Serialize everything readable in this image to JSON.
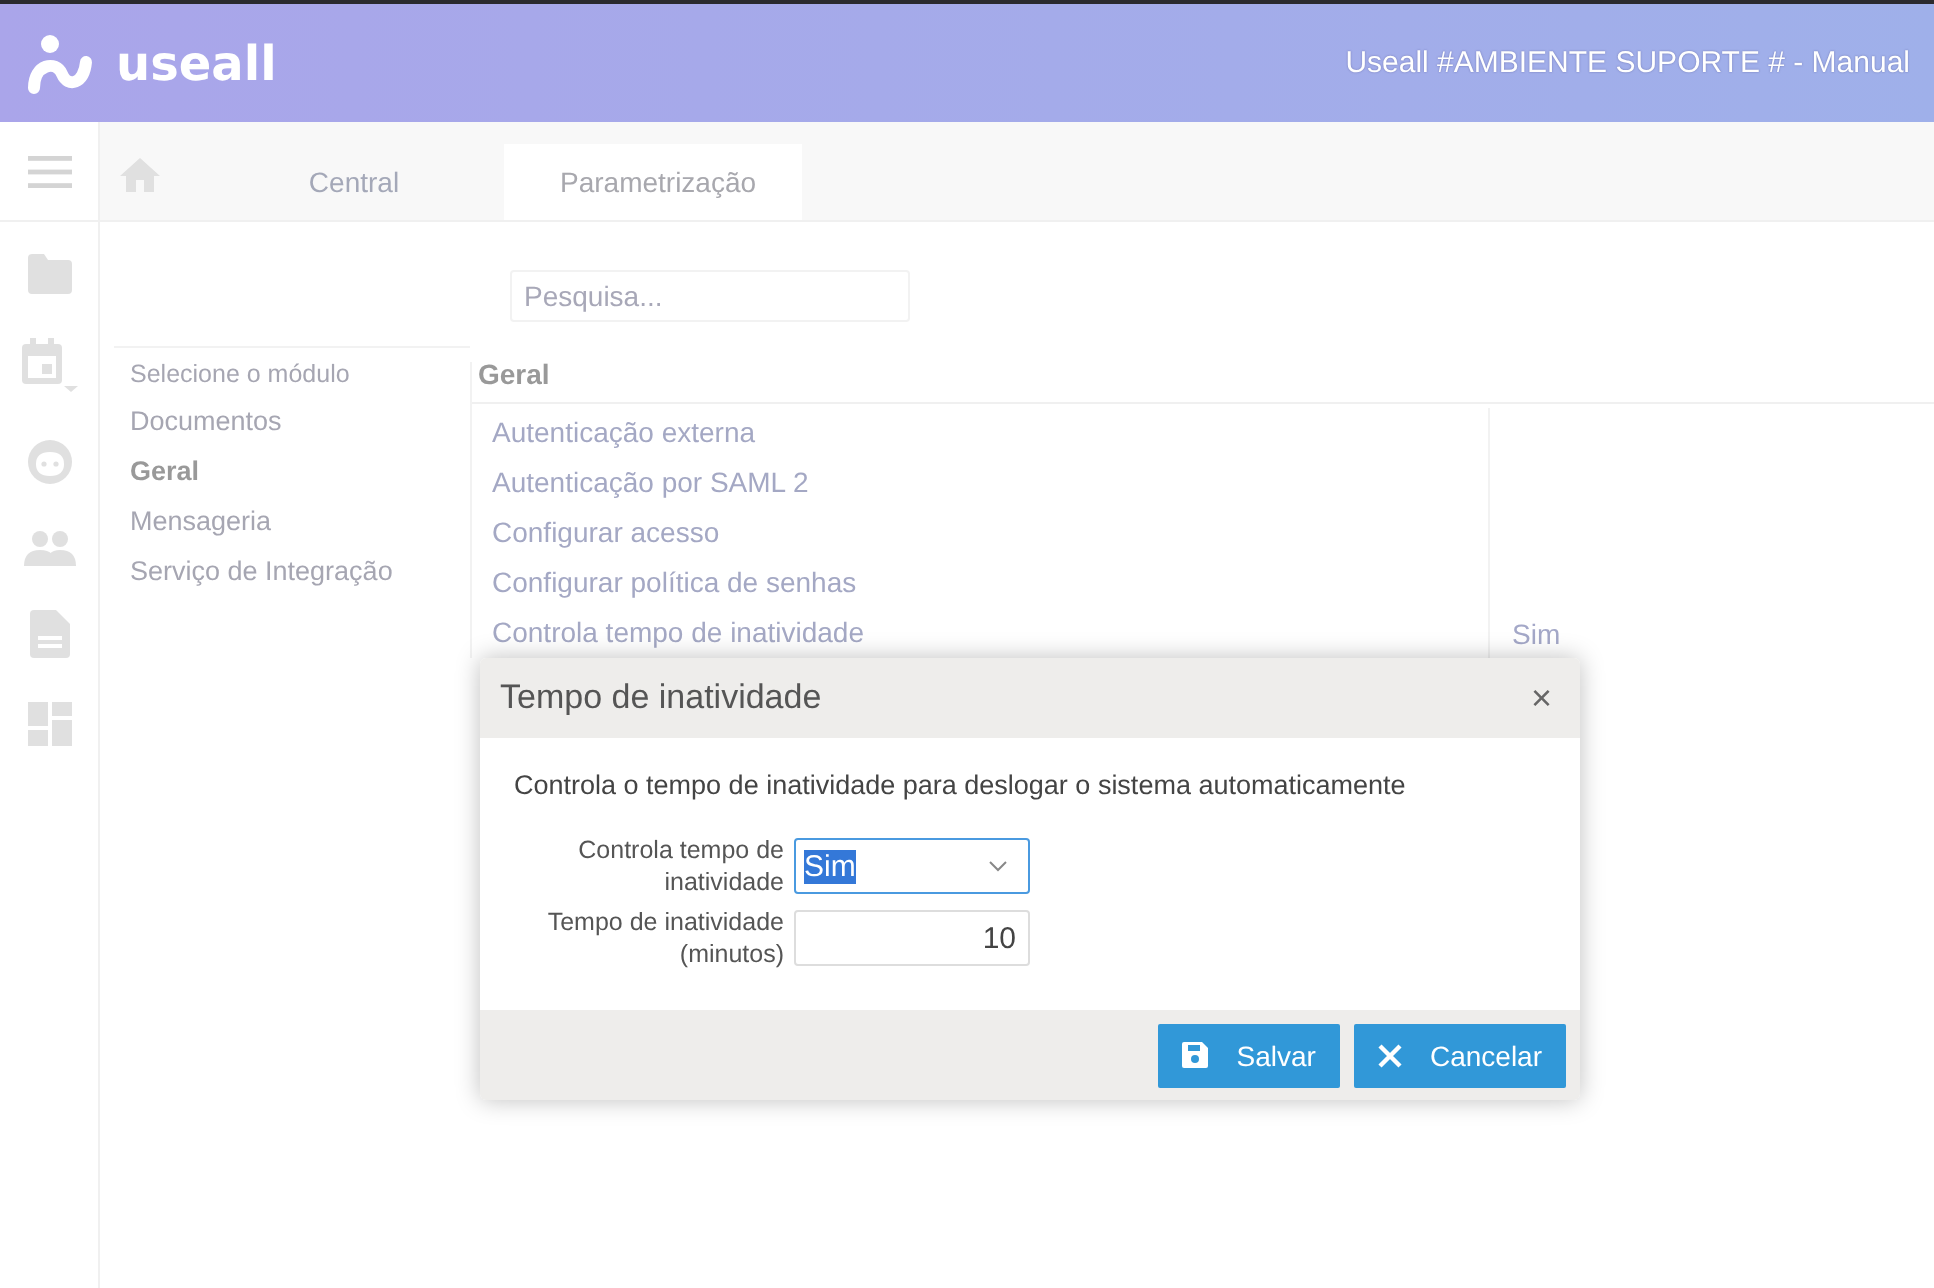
{
  "header": {
    "logo": "useall",
    "title": "Useall #AMBIENTE SUPORTE # - Manual"
  },
  "tabs": [
    {
      "label": "Central",
      "selected": false
    },
    {
      "label": "Parametrização",
      "selected": true
    }
  ],
  "search": {
    "placeholder": "Pesquisa..."
  },
  "modules": {
    "title": "Selecione o módulo",
    "items": [
      {
        "label": "Documentos",
        "selected": false
      },
      {
        "label": "Geral",
        "selected": true
      },
      {
        "label": "Mensageria",
        "selected": false
      },
      {
        "label": "Serviço de Integração",
        "selected": false
      }
    ]
  },
  "section": {
    "title": "Geral",
    "rows": [
      {
        "name": "Autenticação externa"
      },
      {
        "name": "Autenticação por SAML 2"
      },
      {
        "name": "Configurar acesso"
      },
      {
        "name": "Configurar política de senhas"
      },
      {
        "name": "Controla tempo de inatividade",
        "value": "Sim"
      }
    ]
  },
  "dialog": {
    "title": "Tempo de inatividade",
    "close": "×",
    "description": "Controla o tempo de inatividade para deslogar o sistema automaticamente",
    "fields": [
      {
        "kind": "select",
        "label": "Controla tempo de inatividade",
        "value": "Sim",
        "focused": true
      },
      {
        "kind": "number",
        "label": "Tempo de inatividade (minutos)",
        "value": "10",
        "focused": false
      }
    ],
    "buttons": [
      {
        "kind": "save",
        "label": "Salvar"
      },
      {
        "kind": "cancel",
        "label": "Cancelar"
      }
    ]
  }
}
